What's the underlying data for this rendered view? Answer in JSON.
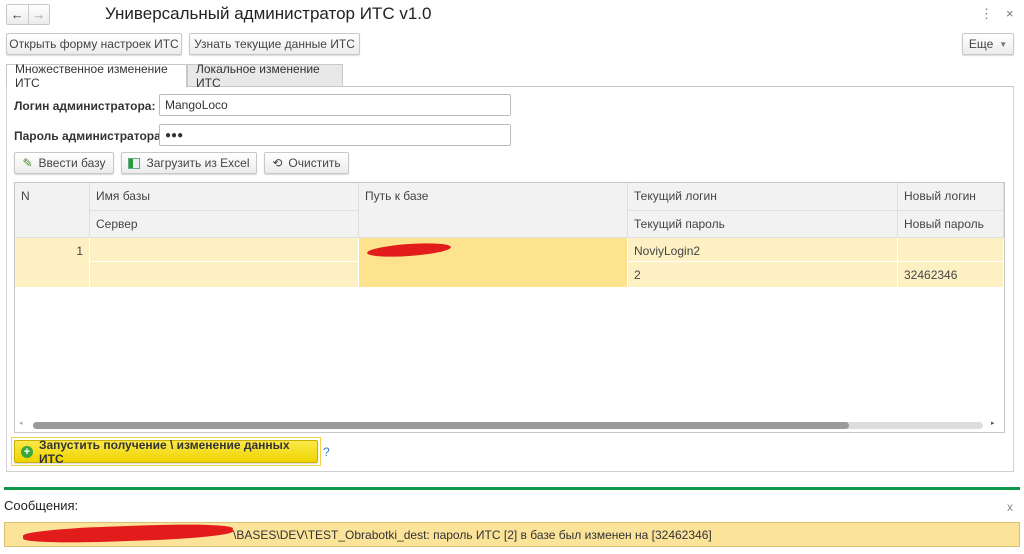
{
  "window": {
    "title": "Универсальный администратор ИТС v1.0",
    "back": "←",
    "forward": "→"
  },
  "toolbar": {
    "open_settings": "Открыть форму настроек ИТС",
    "get_data": "Узнать текущие данные ИТС",
    "more": "Еще"
  },
  "tabs": [
    {
      "label": "Множественное изменение ИТС",
      "active": true
    },
    {
      "label": "Локальное изменение ИТС",
      "active": false
    }
  ],
  "form": {
    "login_label": "Логин администратора:",
    "login_value": "MangoLoco",
    "password_label": "Пароль администратора:",
    "password_value": "●●●"
  },
  "actions": {
    "enter_base": "Ввести базу",
    "load_excel": "Загрузить из Excel",
    "clear": "Очистить"
  },
  "table": {
    "headers": {
      "n": "N",
      "name": "Имя базы",
      "server": "Сервер",
      "path": "Путь к базе",
      "cur_login": "Текущий логин",
      "cur_pass": "Текущий пароль",
      "new_login": "Новый логин",
      "new_pass": "Новый пароль"
    },
    "rows": [
      {
        "n": "1",
        "name": "",
        "server": "",
        "path": "",
        "cur_login": "NoviyLogin2",
        "cur_pass": "2",
        "new_login": "",
        "new_pass": "32462346"
      }
    ]
  },
  "run_button": "Запустить получение \\ изменение данных ИТС",
  "help": "?",
  "messages": {
    "title": "Сообщения:",
    "close": "x",
    "items": [
      "\\BASES\\DEV\\TEST_Obrabotki_dest: пароль ИТС [2] в базе был изменен на [32462346]"
    ]
  },
  "colors": {
    "accent_green": "#0c9a4a",
    "selected_row": "#fde38e",
    "row": "#fdf1c4",
    "run_button": "#f5dc0a",
    "message_bg": "#fbe39a"
  }
}
